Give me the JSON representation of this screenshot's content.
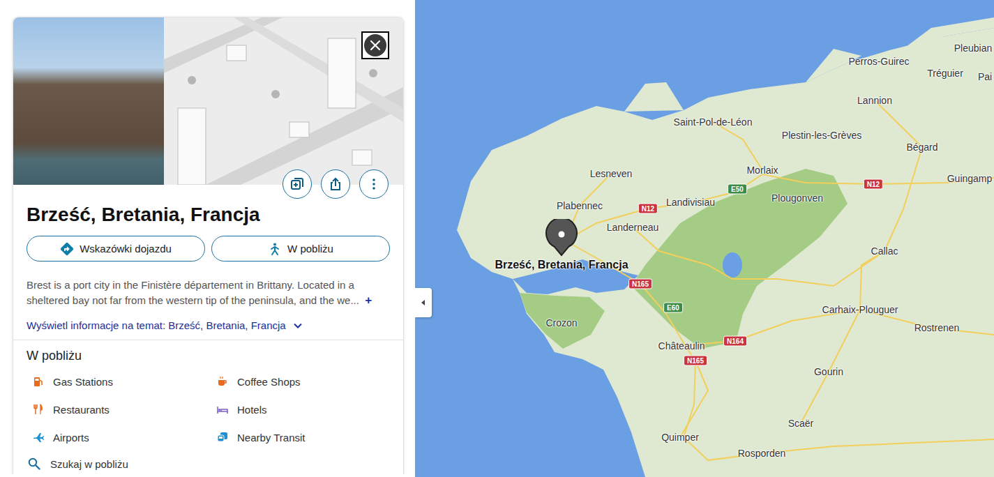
{
  "card": {
    "title": "Brześć, Bretania, Francja",
    "buttons": [
      {
        "label": "Wskazówki dojazdu",
        "kind": "directions"
      },
      {
        "label": "W pobliżu",
        "kind": "nearby"
      }
    ],
    "description": "Brest is a port city in the Finistère département in Brittany. Located in a sheltered bay not far from the western tip of the peninsula, and the we...",
    "expand": "+",
    "more_info": "Wyświetl informacje na temat: Brześć, Bretania, Francja",
    "nearby": {
      "heading": "W pobliżu",
      "items": [
        {
          "label": "Gas Stations",
          "kind": "gas"
        },
        {
          "label": "Coffee Shops",
          "kind": "coffee"
        },
        {
          "label": "Restaurants",
          "kind": "restaurant"
        },
        {
          "label": "Hotels",
          "kind": "hotel"
        },
        {
          "label": "Airports",
          "kind": "airport"
        },
        {
          "label": "Nearby Transit",
          "kind": "transit"
        }
      ],
      "search": {
        "label": "Szukaj w pobliżu"
      }
    }
  },
  "map": {
    "pin": {
      "label": "Brześć, Bretania, Francja"
    },
    "places": [
      {
        "label": "Pleubian"
      },
      {
        "label": "Perros-Guirec"
      },
      {
        "label": "Tréguier"
      },
      {
        "label": "Pai"
      },
      {
        "label": "Guingamp"
      },
      {
        "label": "Lannion"
      },
      {
        "label": "Saint-Pol-de-Léon"
      },
      {
        "label": "Plestin-les-Grèves"
      },
      {
        "label": "Bégard"
      },
      {
        "label": "Lesneven"
      },
      {
        "label": "Morlaix"
      },
      {
        "label": "Landivisiau"
      },
      {
        "label": "Plougonven"
      },
      {
        "label": "Plabennec"
      },
      {
        "label": "Landerneau"
      },
      {
        "label": "Callac"
      },
      {
        "label": "Crozon"
      },
      {
        "label": "Carhaix-Plouguer"
      },
      {
        "label": "Rostrenen"
      },
      {
        "label": "Châteaulin"
      },
      {
        "label": "Gourin"
      },
      {
        "label": "Scaër"
      },
      {
        "label": "Quimper"
      },
      {
        "label": "Rosporden"
      }
    ],
    "roads": [
      {
        "label": "E50",
        "kind": "european"
      },
      {
        "label": "N12",
        "kind": "national"
      },
      {
        "label": "N12",
        "kind": "national"
      },
      {
        "label": "N165",
        "kind": "national"
      },
      {
        "label": "E60",
        "kind": "european"
      },
      {
        "label": "N164",
        "kind": "national"
      },
      {
        "label": "N165",
        "kind": "national"
      }
    ]
  }
}
